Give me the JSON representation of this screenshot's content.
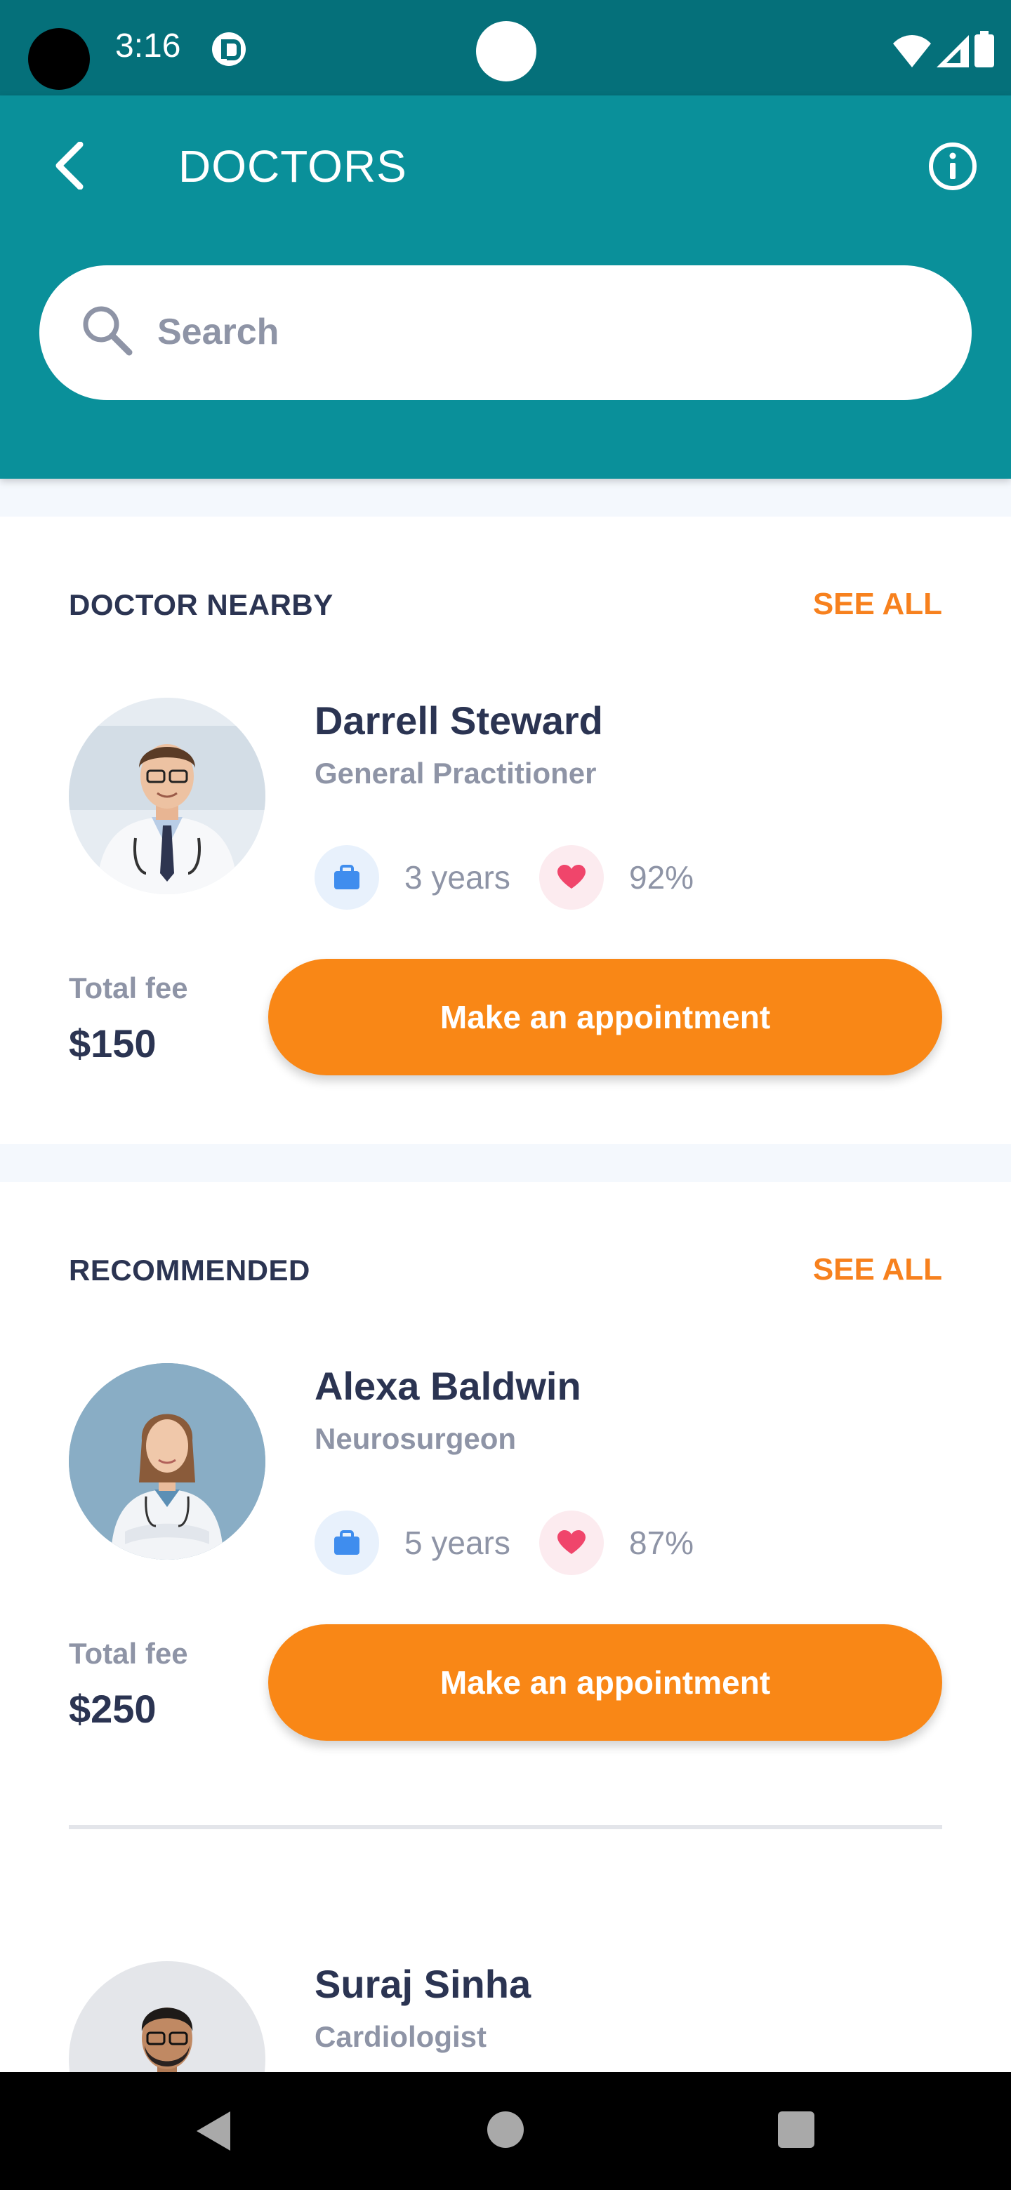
{
  "status_bar": {
    "time": "3:16",
    "icons": [
      "app-notification-icon",
      "wifi-icon",
      "signal-icon",
      "battery-icon"
    ]
  },
  "app_bar": {
    "title": "DOCTORS",
    "back_icon": "chevron-left-icon",
    "info_icon": "info-icon"
  },
  "search": {
    "placeholder": "Search",
    "value": ""
  },
  "sections": [
    {
      "title": "DOCTOR NEARBY",
      "see_all_label": "SEE ALL",
      "doctors": [
        {
          "name": "Darrell Steward",
          "specialty": "General Practitioner",
          "experience": "3 years",
          "rating": "92%",
          "fee_label": "Total fee",
          "fee": "$150",
          "button_label": "Make an appointment"
        }
      ]
    },
    {
      "title": "RECOMMENDED",
      "see_all_label": "SEE ALL",
      "doctors": [
        {
          "name": "Alexa Baldwin",
          "specialty": "Neurosurgeon",
          "experience": "5 years",
          "rating": "87%",
          "fee_label": "Total fee",
          "fee": "$250",
          "button_label": "Make an appointment"
        },
        {
          "name": "Suraj Sinha",
          "specialty": "Cardiologist"
        }
      ]
    }
  ],
  "colors": {
    "status_bar": "#05707A",
    "app_bar": "#0A909A",
    "accent_orange": "#F98716",
    "heading": "#2B3452",
    "muted": "#8E94A6",
    "briefcase_blue": "#3F8DEE",
    "heart_pink": "#F0456B"
  },
  "nav_bar": {
    "icons": [
      "nav-back-icon",
      "nav-home-icon",
      "nav-recents-icon"
    ]
  }
}
